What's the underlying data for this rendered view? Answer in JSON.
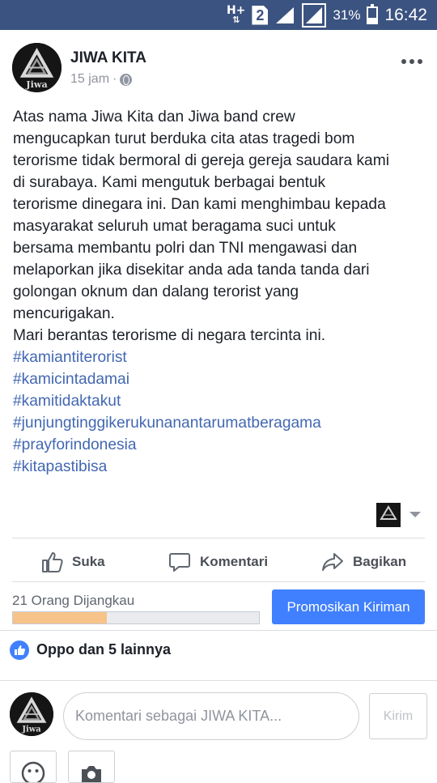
{
  "status_bar": {
    "network": "H+",
    "sim_slot": "2",
    "battery_percent_text": "31%",
    "battery_level": 0.31,
    "time": "16:42"
  },
  "post": {
    "author": "JIWA KITA",
    "avatar_caption": "Jiwa",
    "time": "15 jam",
    "separator": "·",
    "body_lines": [
      "Atas nama Jiwa Kita dan Jiwa band crew",
      "mengucapkan turut berduka cita atas tragedi bom",
      "terorisme tidak bermoral di gereja gereja saudara kami",
      "di surabaya. Kami mengutuk berbagai bentuk",
      "terorisme dinegara ini. Dan kami menghimbau kepada",
      "masyarakat seluruh umat beragama suci untuk",
      "bersama membantu polri dan TNI mengawasi dan",
      "melaporkan jika disekitar anda ada tanda tanda dari",
      "golongan oknum dan dalang terorist yang",
      "mencurigakan.",
      "Mari berantas terorisme di negara tercinta ini."
    ],
    "hashtags": [
      "#kamiantiterorist",
      "#kamicintadamai",
      "#kamitidaktakut",
      "#junjungtinggikerukunanantarumatberagama",
      "#prayforindonesia",
      "#kitapastibisa"
    ]
  },
  "actions": {
    "like": "Suka",
    "comment": "Komentari",
    "share": "Bagikan"
  },
  "reach": {
    "text": "21 Orang Dijangkau",
    "progress": 0.38,
    "promote_label": "Promosikan Kiriman"
  },
  "likes": {
    "summary": "Oppo dan 5 lainnya"
  },
  "composer": {
    "placeholder": "Komentari sebagai JIWA KITA...",
    "send_label": "Kirim"
  },
  "colors": {
    "status_bar": "#3b5380",
    "link": "#4267b2",
    "primary_button": "#4080ff",
    "reach_fill": "#f7c389"
  },
  "icons": {
    "like": "thumbs-up-icon",
    "comment": "speech-bubble-icon",
    "share": "share-arrow-icon",
    "more": "more-horizontal-icon",
    "privacy": "globe-icon",
    "emoji": "emoji-icon",
    "camera": "camera-icon"
  }
}
